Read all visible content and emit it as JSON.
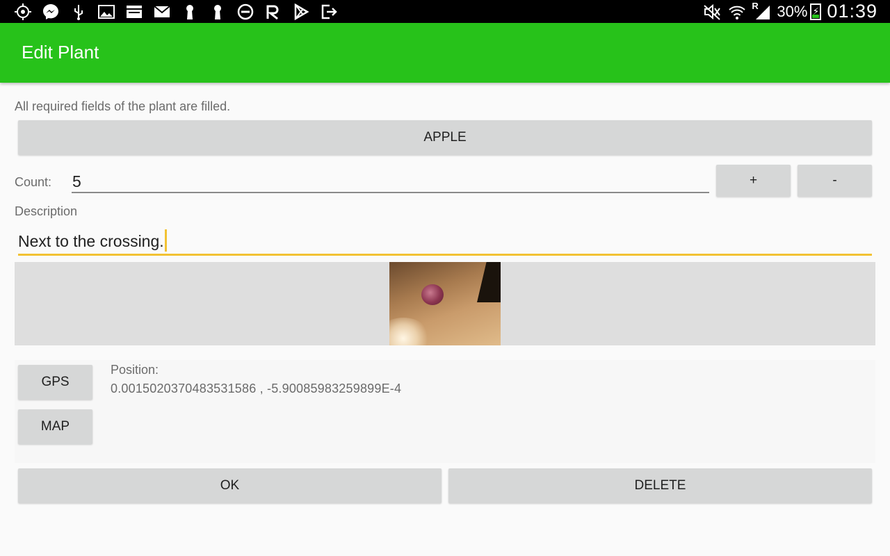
{
  "status_bar": {
    "left_icons": [
      "location-icon",
      "messenger-icon",
      "usb-icon",
      "gallery-icon",
      "app-icon",
      "mail-icon",
      "keyhole-icon",
      "keyhole-icon",
      "do-not-disturb-icon",
      "router-icon",
      "play-store-icon",
      "exit-icon"
    ],
    "right_icons": [
      "mute-icon",
      "wifi-icon",
      "signal-roaming-icon"
    ],
    "roaming_label": "R",
    "battery_percent": "30%",
    "battery_level": 0.3,
    "time": "01:39"
  },
  "app_bar": {
    "title": "Edit Plant",
    "color": "#27c21a"
  },
  "form": {
    "status_message": "All required fields of the plant are filled.",
    "plant_button_label": "APPLE",
    "count_label": "Count:",
    "count_value": "5",
    "plus_label": "+",
    "minus_label": "-",
    "description_label": "Description",
    "description_value": "Next to the crossing.",
    "gps_button_label": "GPS",
    "map_button_label": "MAP",
    "position_label": "Position:",
    "position_value": "0.0015020370483531586 , -5.90085983259899E-4",
    "ok_label": "OK",
    "delete_label": "DELETE"
  },
  "colors": {
    "accent": "#f2c233",
    "button": "#d6d7d7"
  }
}
